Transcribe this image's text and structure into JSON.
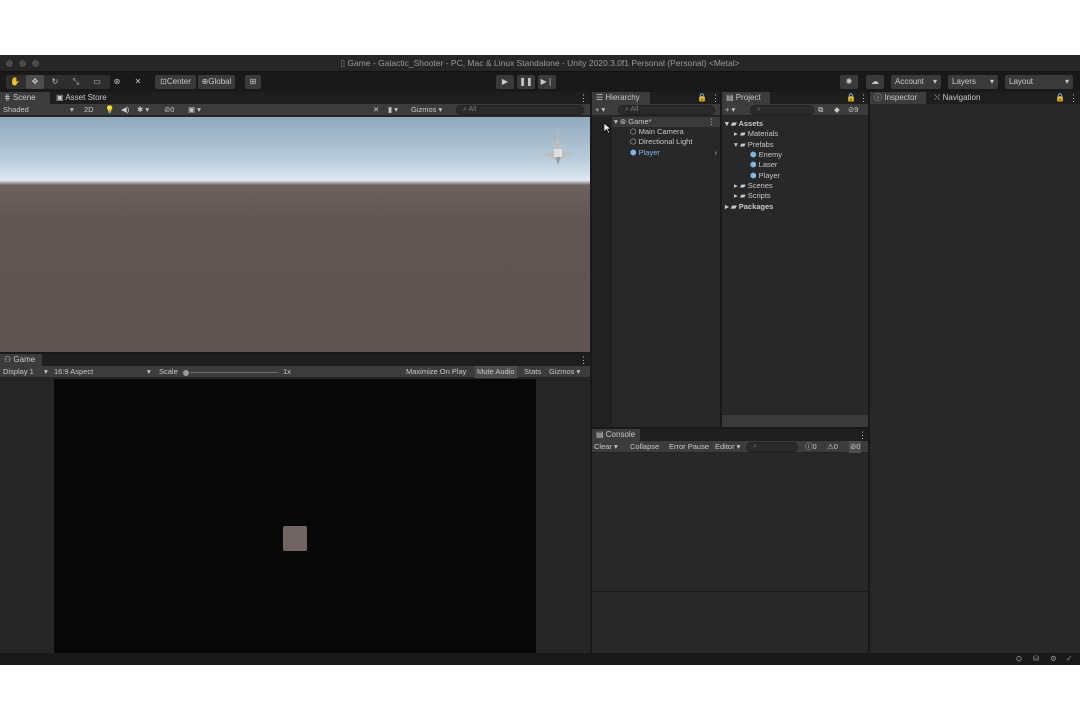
{
  "window": {
    "title": "Game - Galactic_Shooter - PC, Mac & Linux Standalone - Unity 2020.3.0f1 Personal (Personal) <Metal>"
  },
  "toolbar": {
    "pivot_label": "Center",
    "space_label": "Global",
    "account_label": "Account",
    "layers_label": "Layers",
    "layout_label": "Layout"
  },
  "scene_panel": {
    "tabs": [
      "Scene",
      "Asset Store"
    ],
    "shading_mode": "Shaded",
    "mode_2d": "2D",
    "visibility_count": "0",
    "gizmos_label": "Gizmos",
    "search_placeholder": "All"
  },
  "game_panel": {
    "tab_label": "Game",
    "display": "Display 1",
    "aspect": "16:9 Aspect",
    "scale_label": "Scale",
    "scale_value": "1x",
    "maximize_label": "Maximize On Play",
    "mute_label": "Mute Audio",
    "stats_label": "Stats",
    "gizmos_label": "Gizmos"
  },
  "hierarchy": {
    "tab_label": "Hierarchy",
    "search_placeholder": "All",
    "scene_name": "Game*",
    "items": [
      "Main Camera",
      "Directional Light",
      "Player"
    ]
  },
  "project": {
    "tab_label": "Project",
    "visibility_count": "9",
    "assets_label": "Assets",
    "materials_label": "Materials",
    "prefabs_label": "Prefabs",
    "prefab_items": [
      "Enemy",
      "Laser",
      "Player"
    ],
    "scenes_label": "Scenes",
    "scripts_label": "Scripts",
    "packages_label": "Packages"
  },
  "inspector": {
    "tab_label": "Inspector",
    "nav_tab_label": "Navigation"
  },
  "console": {
    "tab_label": "Console",
    "clear_label": "Clear",
    "collapse_label": "Collapse",
    "error_pause_label": "Error Pause",
    "editor_label": "Editor",
    "log_count": "0",
    "warning_count": "0",
    "error_count": "0"
  },
  "colors": {
    "editor_bg": "#191919",
    "panel_bg": "#282828",
    "toolbar_bg": "#3c3c3c",
    "selection": "#2c5d87",
    "ground": "#5e5450",
    "sky_top": "#9fb5c8",
    "game_bg": "#080808",
    "player_square": "#706562"
  },
  "icons": [
    "hand-tool-icon",
    "move-tool-icon",
    "rotate-tool-icon",
    "scale-tool-icon",
    "rect-tool-icon",
    "transform-tool-icon",
    "custom-tool-icon",
    "play-icon",
    "pause-icon",
    "step-icon",
    "collab-icon",
    "cloud-icon",
    "gameobject-icon",
    "prefab-icon",
    "folder-icon"
  ]
}
